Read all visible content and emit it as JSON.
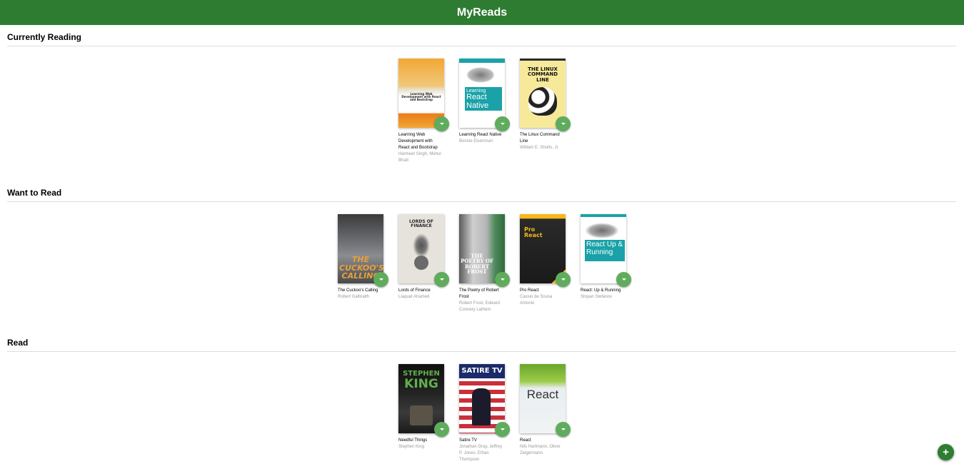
{
  "app": {
    "title": "MyReads",
    "plus_glyph": "+"
  },
  "shelves": [
    {
      "title": "Currently Reading",
      "books": [
        {
          "title": "Learning Web Development with React and Bootstrap",
          "authors": "Harmeet Singh, Mehul Bhatt"
        },
        {
          "title": "Learning React Native",
          "authors": "Bonnie Eisenman"
        },
        {
          "title": "The Linux Command Line",
          "authors": "William E. Shotts, Jr."
        }
      ]
    },
    {
      "title": "Want to Read",
      "books": [
        {
          "title": "The Cuckoo's Calling",
          "authors": "Robert Galbraith"
        },
        {
          "title": "Lords of Finance",
          "authors": "Liaquat Ahamed"
        },
        {
          "title": "The Poetry of Robert Frost",
          "authors": "Robert Frost, Edward Connery Lathem"
        },
        {
          "title": "Pro React",
          "authors": "Cassio de Sousa Antonio"
        },
        {
          "title": "React: Up & Running",
          "authors": "Stoyan Stefanov"
        }
      ]
    },
    {
      "title": "Read",
      "books": [
        {
          "title": "Needful Things",
          "authors": "Stephen King"
        },
        {
          "title": "Satire TV",
          "authors": "Jonathan Gray, Jeffrey P. Jones, Ethan Thompson"
        },
        {
          "title": "React",
          "authors": "Nils Hartmann, Oliver Zeigermann"
        }
      ]
    }
  ],
  "covers": {
    "lwd": {
      "text": "Learning Web Development with React and Bootstrap"
    },
    "lrn": {
      "line1": "Learning",
      "line2": "React",
      "line3": "Native"
    },
    "linux": {
      "text": "THE LINUX COMMAND LINE"
    },
    "cuckoo": {
      "text": "THE CUCKOO'S CALLING"
    },
    "lords": {
      "text": "LORDS OF FINANCE"
    },
    "frost": {
      "text": "THE POETRY OF ROBERT FROST"
    },
    "prore": {
      "line1": "Pro",
      "line2": "React"
    },
    "rur": {
      "text": "React Up & Running"
    },
    "king": {
      "line1": "STEPHEN",
      "line2": "KING"
    },
    "satire": {
      "text": "SATIRE TV"
    },
    "react": {
      "text": "React"
    }
  },
  "colors": {
    "header": "#2e7c31",
    "changer": "#60ac5d",
    "fab": "#2e7d32"
  }
}
